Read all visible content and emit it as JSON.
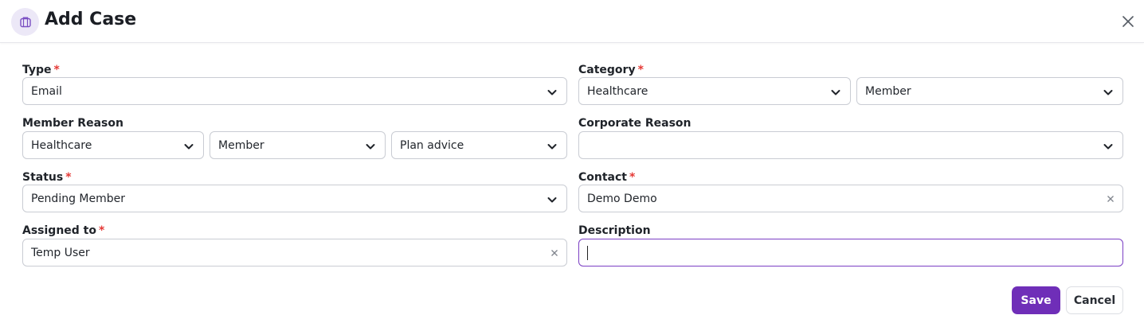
{
  "header": {
    "title": "Add Case",
    "icon": "briefcase-icon"
  },
  "form": {
    "type": {
      "label": "Type",
      "required": "*",
      "value": "Email"
    },
    "category": {
      "label": "Category",
      "required": "*",
      "value1": "Healthcare",
      "value2": "Member"
    },
    "member_reason": {
      "label": "Member Reason",
      "value1": "Healthcare",
      "value2": "Member",
      "value3": "Plan advice"
    },
    "corporate_reason": {
      "label": "Corporate Reason",
      "value": ""
    },
    "status": {
      "label": "Status",
      "required": "*",
      "value": "Pending Member"
    },
    "contact": {
      "label": "Contact",
      "required": "*",
      "value": "Demo Demo"
    },
    "assigned_to": {
      "label": "Assigned to",
      "required": "*",
      "value": "Temp User"
    },
    "description": {
      "label": "Description",
      "value": ""
    }
  },
  "actions": {
    "save_label": "Save",
    "cancel_label": "Cancel"
  },
  "colors": {
    "accent": "#6f2eb8",
    "required": "#e53935",
    "focus_border": "#7b3fc4"
  }
}
